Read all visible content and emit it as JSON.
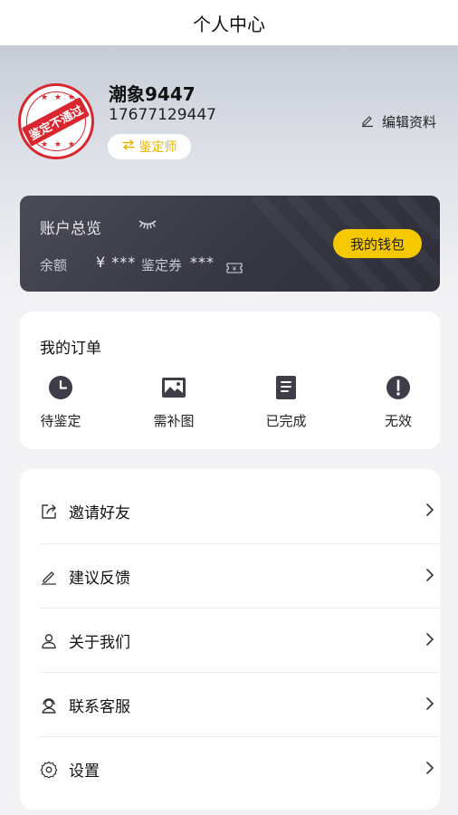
{
  "header": {
    "title": "个人中心"
  },
  "profile": {
    "avatar_stamp_text": "鉴定不通过",
    "username": "潮象9447",
    "phone": "17677129447",
    "role": "鉴定师",
    "edit_label": "编辑资料"
  },
  "account": {
    "title": "账户总览",
    "balance_label": "余额",
    "balance_value": "¥ ***",
    "coupon_label": "鉴定券",
    "coupon_value": "***",
    "wallet_button": "我的钱包"
  },
  "orders": {
    "heading": "我的订单",
    "items": [
      {
        "label": "待鉴定",
        "icon": "clock-icon"
      },
      {
        "label": "需补图",
        "icon": "image-icon"
      },
      {
        "label": "已完成",
        "icon": "document-icon"
      },
      {
        "label": "无效",
        "icon": "alert-icon"
      }
    ]
  },
  "menu": {
    "items": [
      {
        "label": "邀请好友",
        "icon": "share-icon"
      },
      {
        "label": "建议反馈",
        "icon": "pencil-icon"
      },
      {
        "label": "关于我们",
        "icon": "person-icon"
      },
      {
        "label": "联系客服",
        "icon": "headset-icon"
      },
      {
        "label": "设置",
        "icon": "gear-icon"
      }
    ]
  },
  "colors": {
    "accent_yellow": "#f5c800",
    "stamp_red": "#d9262f",
    "card_dark": "#353641"
  }
}
